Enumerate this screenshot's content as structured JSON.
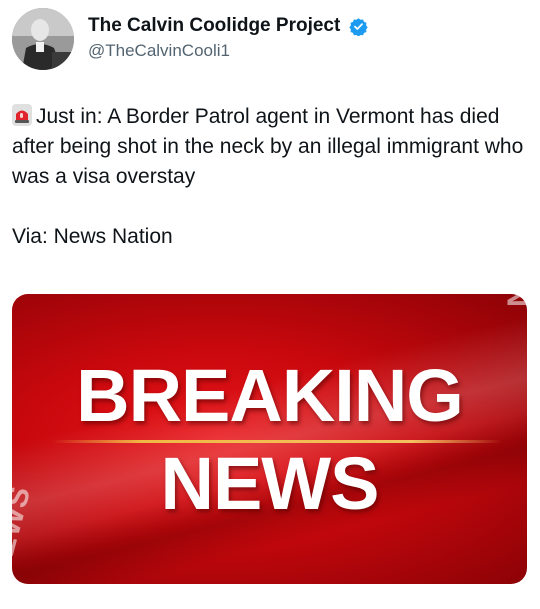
{
  "author": {
    "display_name": "The Calvin Coolidge Project",
    "handle": "@TheCalvinCooli1",
    "verified_icon": "verified-badge-icon",
    "avatar_icon": "portrait-avatar"
  },
  "tweet": {
    "emoji_icon": "police-siren-icon",
    "body": "Just in: A Border Patrol agent in Vermont has died after being shot in the neck by an illegal immigrant who was a visa overstay",
    "via": "Via: News Nation"
  },
  "media": {
    "headline_line1": "BREAKING",
    "headline_line2": "NEWS",
    "side_text_right": "EAKIN",
    "side_text_left": "NEWS",
    "colors": {
      "background": "#d10a0f",
      "accent_line": "#f2b844"
    }
  }
}
